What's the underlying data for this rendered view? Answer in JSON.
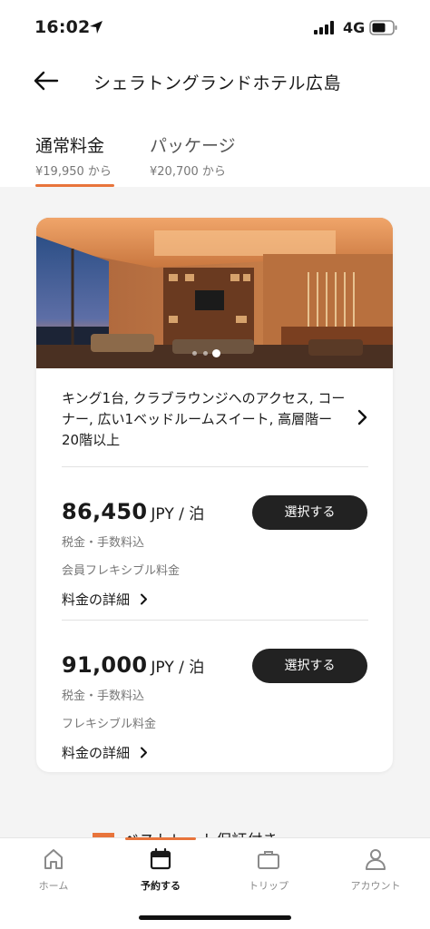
{
  "status_bar": {
    "time": "16:02",
    "network": "4G"
  },
  "header": {
    "title": "シェラトングランドホテル広島"
  },
  "rate_tabs": [
    {
      "label": "通常料金",
      "sub": "¥19,950 から",
      "active": true
    },
    {
      "label": "パッケージ",
      "sub": "¥20,700 から",
      "active": false
    }
  ],
  "room": {
    "description": "キング1台, クラブラウンジへのアクセス, コーナー, 広い1ベッドルームスイート, 高層階ー20階以上",
    "carousel": {
      "count": 3,
      "active_index": 2
    },
    "rates": [
      {
        "amount": "86,450",
        "unit": "JPY / 泊",
        "tax_note": "税金・手数料込",
        "plan": "会員フレキシブル料金",
        "detail_link": "料金の詳細",
        "select_label": "選択する"
      },
      {
        "amount": "91,000",
        "unit": "JPY / 泊",
        "tax_note": "税金・手数料込",
        "plan": "フレキシブル料金",
        "detail_link": "料金の詳細",
        "select_label": "選択する"
      }
    ]
  },
  "peek_text": "ベストレート保証付き",
  "tab_bar": {
    "items": [
      {
        "label": "ホーム",
        "icon": "home-icon",
        "active": false
      },
      {
        "label": "予約する",
        "icon": "calendar-icon",
        "active": true
      },
      {
        "label": "トリップ",
        "icon": "briefcase-icon",
        "active": false
      },
      {
        "label": "アカウント",
        "icon": "person-icon",
        "active": false
      }
    ]
  },
  "colors": {
    "accent": "#e8743b",
    "button": "#222222",
    "background": "#f4f4f4"
  }
}
